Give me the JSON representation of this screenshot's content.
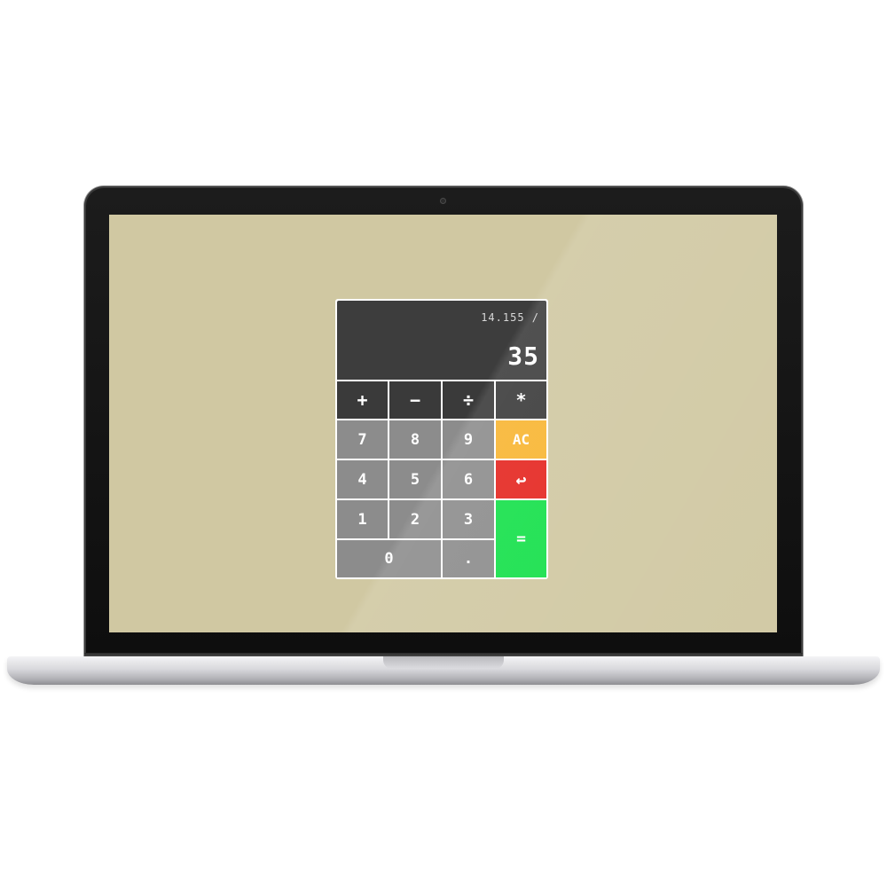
{
  "calculator": {
    "expression": "14.155 /",
    "result": "35",
    "operators": {
      "plus": "+",
      "minus": "−",
      "divide": "÷",
      "multiply": "*"
    },
    "digits": {
      "seven": "7",
      "eight": "8",
      "nine": "9",
      "four": "4",
      "five": "5",
      "six": "6",
      "one": "1",
      "two": "2",
      "three": "3",
      "zero": "0",
      "decimal": "."
    },
    "actions": {
      "clear": "AC",
      "backspace": "↩",
      "equals": "="
    }
  },
  "colors": {
    "screen_background": "#d0c8a2",
    "display": "#3d3d3d",
    "operator_key": "#3a3a3a",
    "digit_key": "#8c8c8c",
    "clear_key": "#f8b532",
    "backspace_key": "#e52620",
    "equals_key": "#15e04a"
  }
}
